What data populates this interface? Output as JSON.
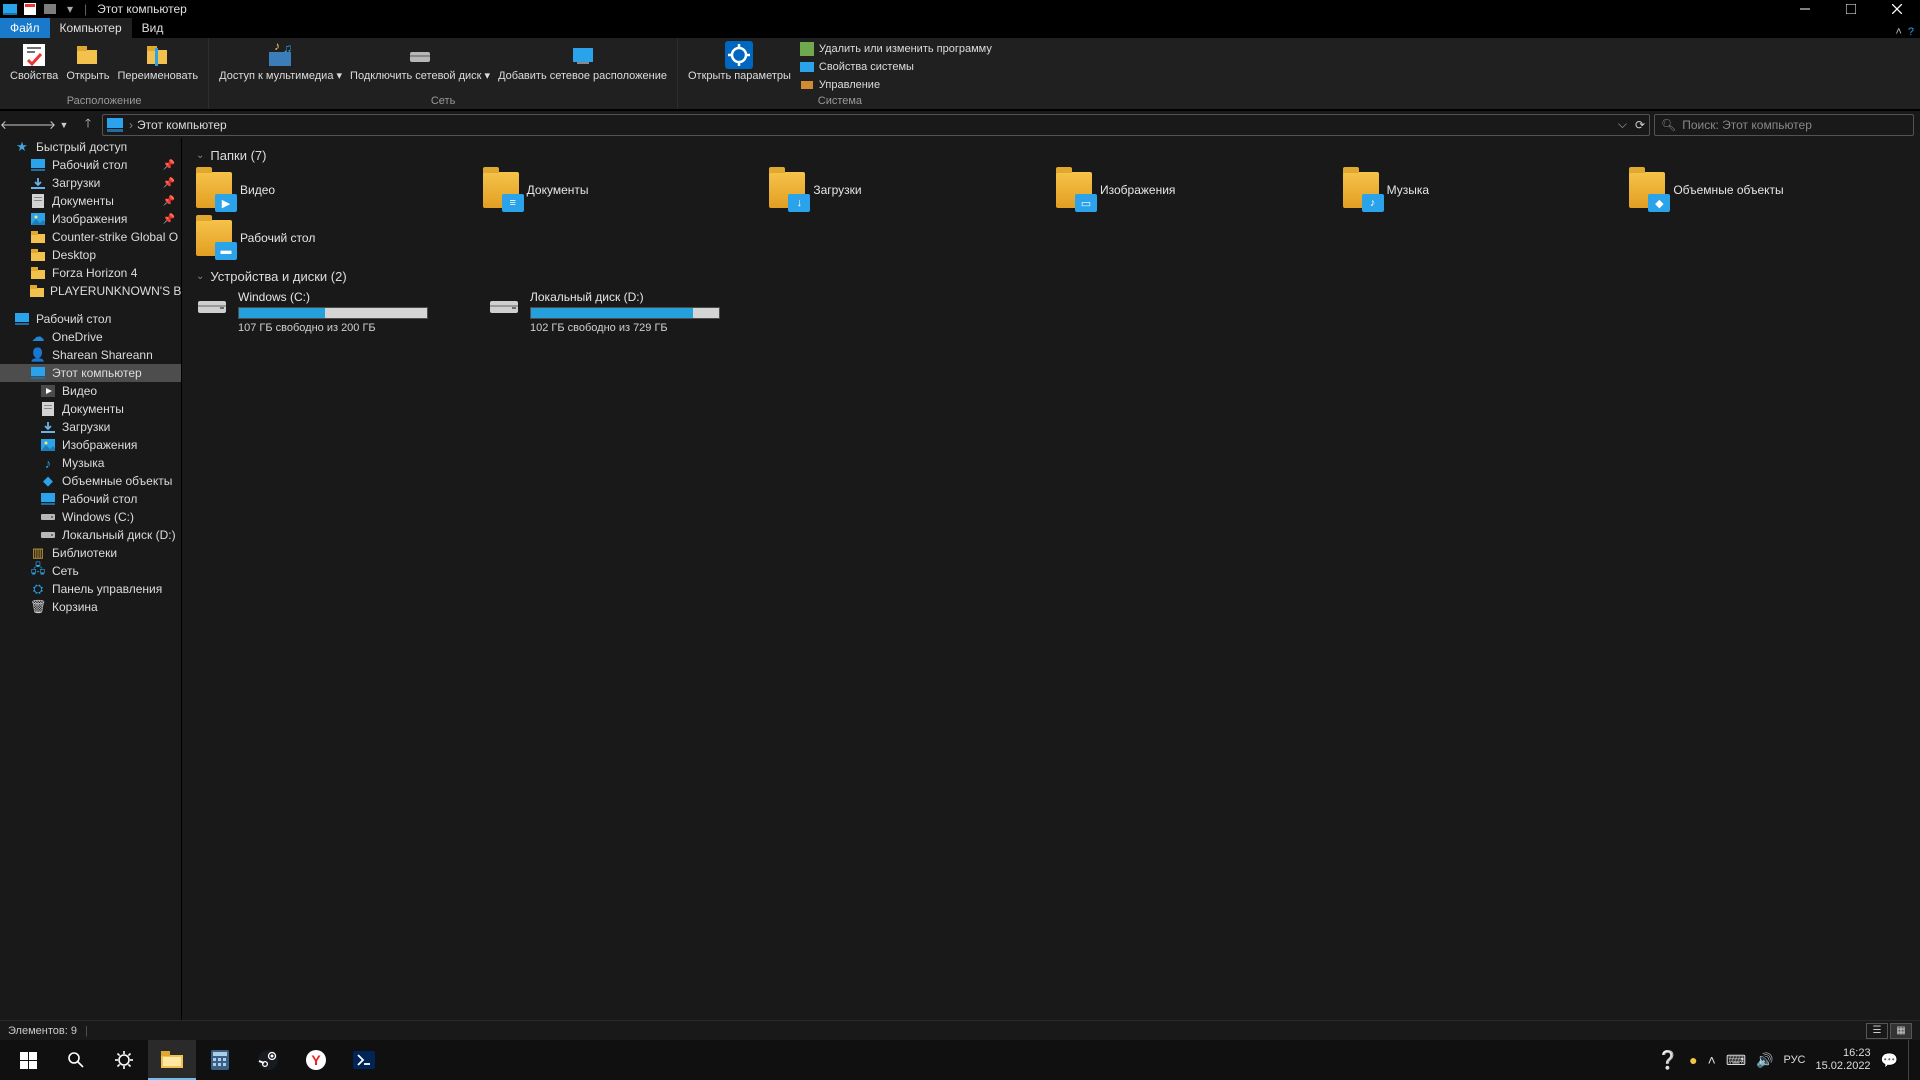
{
  "title": "Этот компьютер",
  "tabs": {
    "file": "Файл",
    "computer": "Компьютер",
    "view": "Вид"
  },
  "ribbon": {
    "group_location": "Расположение",
    "group_network": "Сеть",
    "group_system": "Система",
    "properties": "Свойства",
    "open": "Открыть",
    "rename": "Переименовать",
    "media_access": "Доступ к\nмультимедиа",
    "map_drive": "Подключить\nсетевой диск",
    "add_netloc": "Добавить сетевое\nрасположение",
    "open_settings": "Открыть\nпараметры",
    "uninstall": "Удалить или изменить программу",
    "sys_props": "Свойства системы",
    "manage": "Управление"
  },
  "address": {
    "path": "Этот компьютер",
    "search_placeholder": "Поиск: Этот компьютер"
  },
  "tree": {
    "quick_access": "Быстрый доступ",
    "qa_items": [
      {
        "label": "Рабочий стол",
        "icon": "desktop",
        "pin": true
      },
      {
        "label": "Загрузки",
        "icon": "downloads",
        "pin": true
      },
      {
        "label": "Документы",
        "icon": "documents",
        "pin": true
      },
      {
        "label": "Изображения",
        "icon": "pictures",
        "pin": true
      },
      {
        "label": "Counter-strike  Global O",
        "icon": "folder"
      },
      {
        "label": "Desktop",
        "icon": "folder"
      },
      {
        "label": "Forza Horizon 4",
        "icon": "folder"
      },
      {
        "label": "PLAYERUNKNOWN'S BA",
        "icon": "folder"
      }
    ],
    "desktop": "Рабочий стол",
    "onedrive": "OneDrive",
    "user": "Sharean Shareann",
    "this_pc": "Этот компьютер",
    "pc_items": [
      {
        "label": "Видео",
        "icon": "video"
      },
      {
        "label": "Документы",
        "icon": "documents"
      },
      {
        "label": "Загрузки",
        "icon": "downloads"
      },
      {
        "label": "Изображения",
        "icon": "pictures"
      },
      {
        "label": "Музыка",
        "icon": "music"
      },
      {
        "label": "Объемные объекты",
        "icon": "3d"
      },
      {
        "label": "Рабочий стол",
        "icon": "desktop"
      },
      {
        "label": "Windows (C:)",
        "icon": "drive"
      },
      {
        "label": "Локальный диск (D:)",
        "icon": "drive"
      }
    ],
    "libraries": "Библиотеки",
    "network": "Сеть",
    "control_panel": "Панель управления",
    "recycle": "Корзина"
  },
  "content": {
    "folders_header": "Папки (7)",
    "drives_header": "Устройства и диски (2)",
    "folders": [
      {
        "label": "Видео",
        "badge": "▶"
      },
      {
        "label": "Документы",
        "badge": "≡"
      },
      {
        "label": "Загрузки",
        "badge": "↓"
      },
      {
        "label": "Изображения",
        "badge": "▭"
      },
      {
        "label": "Музыка",
        "badge": "♪"
      },
      {
        "label": "Объемные объекты",
        "badge": "◆"
      },
      {
        "label": "Рабочий стол",
        "badge": "▬"
      }
    ],
    "drives": [
      {
        "name": "Windows (C:)",
        "free": "107 ГБ свободно из 200 ГБ",
        "pct": 46
      },
      {
        "name": "Локальный диск (D:)",
        "free": "102 ГБ свободно из 729 ГБ",
        "pct": 86
      }
    ]
  },
  "status": {
    "items": "Элементов: 9"
  },
  "taskbar": {
    "lang": "РУС",
    "time": "16:23",
    "date": "15.02.2022"
  }
}
